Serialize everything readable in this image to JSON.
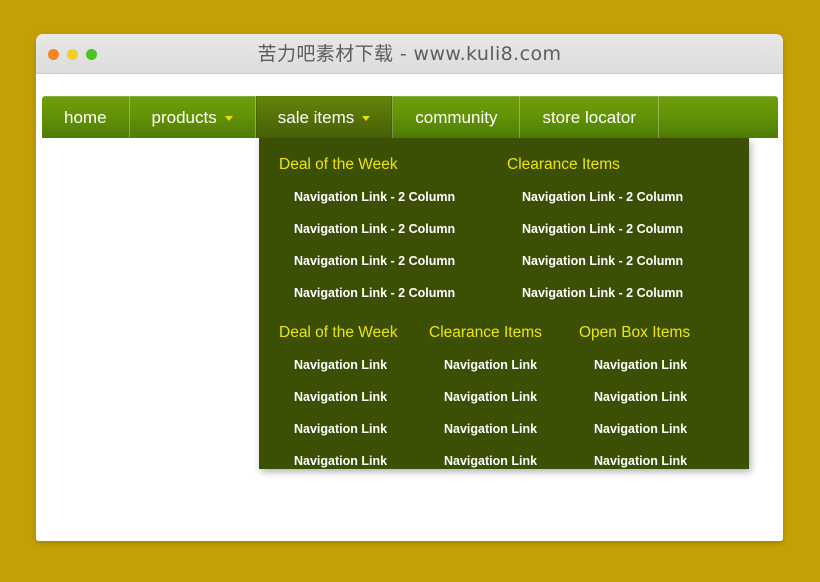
{
  "window": {
    "title": "苦力吧素材下载 - www.kuli8.com",
    "traffic_lights": [
      {
        "name": "close",
        "color": "#f5861f"
      },
      {
        "name": "minimize",
        "color": "#f2d024"
      },
      {
        "name": "zoom",
        "color": "#4ec326"
      }
    ]
  },
  "colors": {
    "page_background": "#c3a006",
    "nav_green": "#639306",
    "nav_active_green": "#546f07",
    "dropdown_background": "#3b4f05",
    "heading_yellow": "#efe60d",
    "link_white": "#ffffff",
    "caret_yellow": "#e8e00a"
  },
  "nav": {
    "items": [
      {
        "label": "home",
        "has_caret": false,
        "active": false
      },
      {
        "label": "products",
        "has_caret": true,
        "active": false
      },
      {
        "label": "sale items",
        "has_caret": true,
        "active": true
      },
      {
        "label": "community",
        "has_caret": false,
        "active": false
      },
      {
        "label": "store locator",
        "has_caret": false,
        "active": false
      }
    ]
  },
  "dropdown": {
    "two_column": {
      "columns": [
        {
          "heading": "Deal of the Week",
          "links": [
            "Navigation Link - 2 Column",
            "Navigation Link - 2 Column",
            "Navigation Link - 2 Column",
            "Navigation Link - 2 Column"
          ]
        },
        {
          "heading": "Clearance Items",
          "links": [
            "Navigation Link - 2 Column",
            "Navigation Link - 2 Column",
            "Navigation Link - 2 Column",
            "Navigation Link - 2 Column"
          ]
        }
      ]
    },
    "three_column": {
      "columns": [
        {
          "heading": "Deal of the Week",
          "links": [
            "Navigation Link",
            "Navigation Link",
            "Navigation Link",
            "Navigation Link"
          ]
        },
        {
          "heading": "Clearance Items",
          "links": [
            "Navigation Link",
            "Navigation Link",
            "Navigation Link",
            "Navigation Link"
          ]
        },
        {
          "heading": "Open Box Items",
          "links": [
            "Navigation Link",
            "Navigation Link",
            "Navigation Link",
            "Navigation Link"
          ]
        }
      ]
    }
  }
}
